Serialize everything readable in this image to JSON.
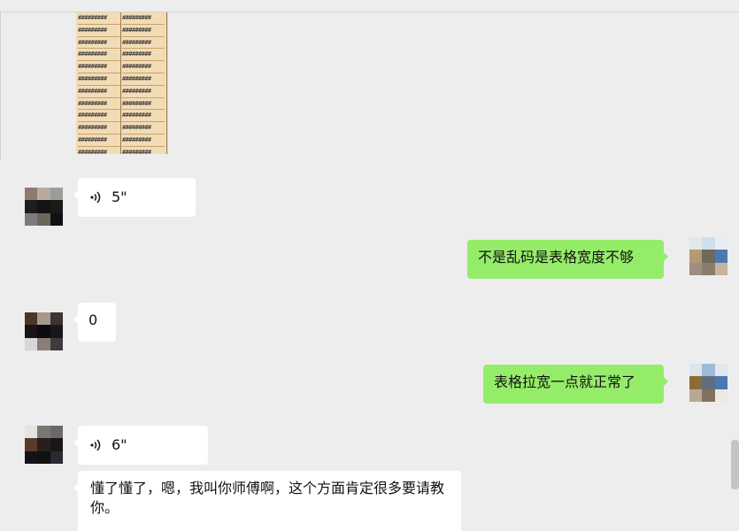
{
  "screenshot_cells": [
    "#########",
    "#########",
    "#########",
    "#########",
    "#########",
    "#########",
    "#########",
    "#########",
    "#########",
    "#########",
    "#########",
    "#########",
    "#########"
  ],
  "messages": [
    {
      "type": "voice",
      "side": "in",
      "duration": "5\""
    },
    {
      "type": "text",
      "side": "out",
      "text": "不是乱码是表格宽度不够"
    },
    {
      "type": "text",
      "side": "in",
      "text": "0"
    },
    {
      "type": "text",
      "side": "out",
      "text": "表格拉宽一点就正常了"
    },
    {
      "type": "voice",
      "side": "in",
      "duration": "6\""
    },
    {
      "type": "text",
      "side": "in",
      "text": "懂了懂了，嗯，我叫你师傅啊，这个方面肯定很多要请教你。"
    }
  ],
  "colors": {
    "background": "#ededed",
    "outgoing_bubble": "#95ec69",
    "incoming_bubble": "#ffffff"
  }
}
